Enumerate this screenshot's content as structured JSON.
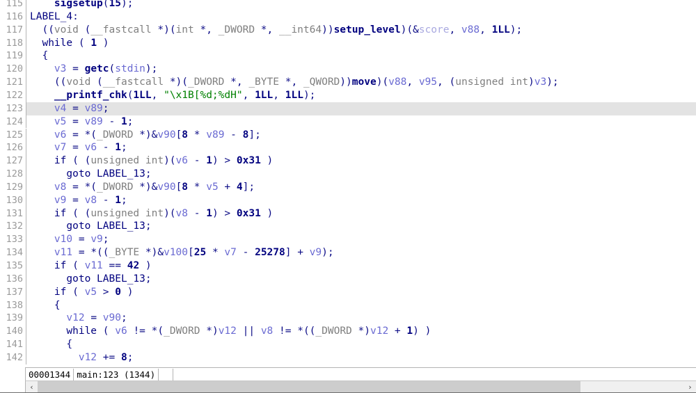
{
  "view": {
    "kind": "hex-rays-pseudocode",
    "first_visible_line": 115,
    "highlighted_line": 123,
    "colors": {
      "background": "#ffffff",
      "highlight": "#e3e3e3",
      "gutter_text": "#9a9a9a",
      "keyword": "#00007f",
      "type": "#7f7f7f",
      "function": "#00007f",
      "local_var": "#6a6ad2",
      "global_var": "#a9a9e0",
      "number": "#00007f",
      "string": "#008000"
    }
  },
  "lines": [
    {
      "num": "115",
      "tokens": [
        {
          "t": "    ",
          "c": "t-plain"
        },
        {
          "t": "sigsetup",
          "c": "t-fn"
        },
        {
          "t": "(",
          "c": "t-plain"
        },
        {
          "t": "15",
          "c": "t-num"
        },
        {
          "t": ");",
          "c": "t-plain"
        }
      ]
    },
    {
      "num": "116",
      "tokens": [
        {
          "t": "LABEL_4",
          "c": "t-label"
        },
        {
          "t": ":",
          "c": "t-plain"
        }
      ]
    },
    {
      "num": "117",
      "tokens": [
        {
          "t": "  ((",
          "c": "t-plain"
        },
        {
          "t": "void",
          "c": "t-type"
        },
        {
          "t": " (",
          "c": "t-plain"
        },
        {
          "t": "__fastcall",
          "c": "t-type"
        },
        {
          "t": " *)(",
          "c": "t-plain"
        },
        {
          "t": "int",
          "c": "t-type"
        },
        {
          "t": " *, ",
          "c": "t-plain"
        },
        {
          "t": "_DWORD",
          "c": "t-type"
        },
        {
          "t": " *, ",
          "c": "t-plain"
        },
        {
          "t": "__int64",
          "c": "t-type"
        },
        {
          "t": "))",
          "c": "t-plain"
        },
        {
          "t": "setup_level",
          "c": "t-fn"
        },
        {
          "t": ")(&",
          "c": "t-plain"
        },
        {
          "t": "score",
          "c": "t-gvar"
        },
        {
          "t": ", ",
          "c": "t-plain"
        },
        {
          "t": "v88",
          "c": "t-var"
        },
        {
          "t": ", ",
          "c": "t-plain"
        },
        {
          "t": "1LL",
          "c": "t-num"
        },
        {
          "t": ");",
          "c": "t-plain"
        }
      ]
    },
    {
      "num": "118",
      "tokens": [
        {
          "t": "  ",
          "c": "t-plain"
        },
        {
          "t": "while",
          "c": "t-kw"
        },
        {
          "t": " ( ",
          "c": "t-plain"
        },
        {
          "t": "1",
          "c": "t-num"
        },
        {
          "t": " )",
          "c": "t-plain"
        }
      ]
    },
    {
      "num": "119",
      "tokens": [
        {
          "t": "  {",
          "c": "t-plain"
        }
      ]
    },
    {
      "num": "120",
      "tokens": [
        {
          "t": "    ",
          "c": "t-plain"
        },
        {
          "t": "v3",
          "c": "t-var"
        },
        {
          "t": " = ",
          "c": "t-plain"
        },
        {
          "t": "getc",
          "c": "t-fn"
        },
        {
          "t": "(",
          "c": "t-plain"
        },
        {
          "t": "stdin",
          "c": "t-var"
        },
        {
          "t": ");",
          "c": "t-plain"
        }
      ]
    },
    {
      "num": "121",
      "tokens": [
        {
          "t": "    ((",
          "c": "t-plain"
        },
        {
          "t": "void",
          "c": "t-type"
        },
        {
          "t": " (",
          "c": "t-plain"
        },
        {
          "t": "__fastcall",
          "c": "t-type"
        },
        {
          "t": " *)(",
          "c": "t-plain"
        },
        {
          "t": "_DWORD",
          "c": "t-type"
        },
        {
          "t": " *, ",
          "c": "t-plain"
        },
        {
          "t": "_BYTE",
          "c": "t-type"
        },
        {
          "t": " *, ",
          "c": "t-plain"
        },
        {
          "t": "_QWORD",
          "c": "t-type"
        },
        {
          "t": "))",
          "c": "t-plain"
        },
        {
          "t": "move",
          "c": "t-fn"
        },
        {
          "t": ")(",
          "c": "t-plain"
        },
        {
          "t": "v88",
          "c": "t-var"
        },
        {
          "t": ", ",
          "c": "t-plain"
        },
        {
          "t": "v95",
          "c": "t-var"
        },
        {
          "t": ", (",
          "c": "t-plain"
        },
        {
          "t": "unsigned int",
          "c": "t-type"
        },
        {
          "t": ")",
          "c": "t-plain"
        },
        {
          "t": "v3",
          "c": "t-var"
        },
        {
          "t": ");",
          "c": "t-plain"
        }
      ]
    },
    {
      "num": "122",
      "tokens": [
        {
          "t": "    ",
          "c": "t-plain"
        },
        {
          "t": "__printf_chk",
          "c": "t-fn"
        },
        {
          "t": "(",
          "c": "t-plain"
        },
        {
          "t": "1LL",
          "c": "t-num"
        },
        {
          "t": ", ",
          "c": "t-plain"
        },
        {
          "t": "\"\\x1B[%d;%dH\"",
          "c": "t-str"
        },
        {
          "t": ", ",
          "c": "t-plain"
        },
        {
          "t": "1LL",
          "c": "t-num"
        },
        {
          "t": ", ",
          "c": "t-plain"
        },
        {
          "t": "1LL",
          "c": "t-num"
        },
        {
          "t": ");",
          "c": "t-plain"
        }
      ]
    },
    {
      "num": "123",
      "highlight": true,
      "tokens": [
        {
          "t": "    ",
          "c": "t-plain"
        },
        {
          "t": "v4",
          "c": "t-var"
        },
        {
          "t": " = ",
          "c": "t-plain"
        },
        {
          "t": "v89",
          "c": "t-var"
        },
        {
          "t": ";",
          "c": "t-plain"
        }
      ]
    },
    {
      "num": "124",
      "tokens": [
        {
          "t": "    ",
          "c": "t-plain"
        },
        {
          "t": "v5",
          "c": "t-var"
        },
        {
          "t": " = ",
          "c": "t-plain"
        },
        {
          "t": "v89",
          "c": "t-var"
        },
        {
          "t": " - ",
          "c": "t-plain"
        },
        {
          "t": "1",
          "c": "t-num"
        },
        {
          "t": ";",
          "c": "t-plain"
        }
      ]
    },
    {
      "num": "125",
      "tokens": [
        {
          "t": "    ",
          "c": "t-plain"
        },
        {
          "t": "v6",
          "c": "t-var"
        },
        {
          "t": " = *(",
          "c": "t-plain"
        },
        {
          "t": "_DWORD",
          "c": "t-type"
        },
        {
          "t": " *)&",
          "c": "t-plain"
        },
        {
          "t": "v90",
          "c": "t-var"
        },
        {
          "t": "[",
          "c": "t-plain"
        },
        {
          "t": "8",
          "c": "t-num"
        },
        {
          "t": " * ",
          "c": "t-plain"
        },
        {
          "t": "v89",
          "c": "t-var"
        },
        {
          "t": " - ",
          "c": "t-plain"
        },
        {
          "t": "8",
          "c": "t-num"
        },
        {
          "t": "];",
          "c": "t-plain"
        }
      ]
    },
    {
      "num": "126",
      "tokens": [
        {
          "t": "    ",
          "c": "t-plain"
        },
        {
          "t": "v7",
          "c": "t-var"
        },
        {
          "t": " = ",
          "c": "t-plain"
        },
        {
          "t": "v6",
          "c": "t-var"
        },
        {
          "t": " - ",
          "c": "t-plain"
        },
        {
          "t": "1",
          "c": "t-num"
        },
        {
          "t": ";",
          "c": "t-plain"
        }
      ]
    },
    {
      "num": "127",
      "tokens": [
        {
          "t": "    ",
          "c": "t-plain"
        },
        {
          "t": "if",
          "c": "t-kw"
        },
        {
          "t": " ( (",
          "c": "t-plain"
        },
        {
          "t": "unsigned int",
          "c": "t-type"
        },
        {
          "t": ")(",
          "c": "t-plain"
        },
        {
          "t": "v6",
          "c": "t-var"
        },
        {
          "t": " - ",
          "c": "t-plain"
        },
        {
          "t": "1",
          "c": "t-num"
        },
        {
          "t": ") > ",
          "c": "t-plain"
        },
        {
          "t": "0x31",
          "c": "t-num"
        },
        {
          "t": " )",
          "c": "t-plain"
        }
      ]
    },
    {
      "num": "128",
      "tokens": [
        {
          "t": "      ",
          "c": "t-plain"
        },
        {
          "t": "goto",
          "c": "t-kw"
        },
        {
          "t": " ",
          "c": "t-plain"
        },
        {
          "t": "LABEL_13",
          "c": "t-label"
        },
        {
          "t": ";",
          "c": "t-plain"
        }
      ]
    },
    {
      "num": "129",
      "tokens": [
        {
          "t": "    ",
          "c": "t-plain"
        },
        {
          "t": "v8",
          "c": "t-var"
        },
        {
          "t": " = *(",
          "c": "t-plain"
        },
        {
          "t": "_DWORD",
          "c": "t-type"
        },
        {
          "t": " *)&",
          "c": "t-plain"
        },
        {
          "t": "v90",
          "c": "t-var"
        },
        {
          "t": "[",
          "c": "t-plain"
        },
        {
          "t": "8",
          "c": "t-num"
        },
        {
          "t": " * ",
          "c": "t-plain"
        },
        {
          "t": "v5",
          "c": "t-var"
        },
        {
          "t": " + ",
          "c": "t-plain"
        },
        {
          "t": "4",
          "c": "t-num"
        },
        {
          "t": "];",
          "c": "t-plain"
        }
      ]
    },
    {
      "num": "130",
      "tokens": [
        {
          "t": "    ",
          "c": "t-plain"
        },
        {
          "t": "v9",
          "c": "t-var"
        },
        {
          "t": " = ",
          "c": "t-plain"
        },
        {
          "t": "v8",
          "c": "t-var"
        },
        {
          "t": " - ",
          "c": "t-plain"
        },
        {
          "t": "1",
          "c": "t-num"
        },
        {
          "t": ";",
          "c": "t-plain"
        }
      ]
    },
    {
      "num": "131",
      "tokens": [
        {
          "t": "    ",
          "c": "t-plain"
        },
        {
          "t": "if",
          "c": "t-kw"
        },
        {
          "t": " ( (",
          "c": "t-plain"
        },
        {
          "t": "unsigned int",
          "c": "t-type"
        },
        {
          "t": ")(",
          "c": "t-plain"
        },
        {
          "t": "v8",
          "c": "t-var"
        },
        {
          "t": " - ",
          "c": "t-plain"
        },
        {
          "t": "1",
          "c": "t-num"
        },
        {
          "t": ") > ",
          "c": "t-plain"
        },
        {
          "t": "0x31",
          "c": "t-num"
        },
        {
          "t": " )",
          "c": "t-plain"
        }
      ]
    },
    {
      "num": "132",
      "tokens": [
        {
          "t": "      ",
          "c": "t-plain"
        },
        {
          "t": "goto",
          "c": "t-kw"
        },
        {
          "t": " ",
          "c": "t-plain"
        },
        {
          "t": "LABEL_13",
          "c": "t-label"
        },
        {
          "t": ";",
          "c": "t-plain"
        }
      ]
    },
    {
      "num": "133",
      "tokens": [
        {
          "t": "    ",
          "c": "t-plain"
        },
        {
          "t": "v10",
          "c": "t-var"
        },
        {
          "t": " = ",
          "c": "t-plain"
        },
        {
          "t": "v9",
          "c": "t-var"
        },
        {
          "t": ";",
          "c": "t-plain"
        }
      ]
    },
    {
      "num": "134",
      "tokens": [
        {
          "t": "    ",
          "c": "t-plain"
        },
        {
          "t": "v11",
          "c": "t-var"
        },
        {
          "t": " = *((",
          "c": "t-plain"
        },
        {
          "t": "_BYTE",
          "c": "t-type"
        },
        {
          "t": " *)&",
          "c": "t-plain"
        },
        {
          "t": "v100",
          "c": "t-var"
        },
        {
          "t": "[",
          "c": "t-plain"
        },
        {
          "t": "25",
          "c": "t-num"
        },
        {
          "t": " * ",
          "c": "t-plain"
        },
        {
          "t": "v7",
          "c": "t-var"
        },
        {
          "t": " - ",
          "c": "t-plain"
        },
        {
          "t": "25278",
          "c": "t-num"
        },
        {
          "t": "] + ",
          "c": "t-plain"
        },
        {
          "t": "v9",
          "c": "t-var"
        },
        {
          "t": ");",
          "c": "t-plain"
        }
      ]
    },
    {
      "num": "135",
      "tokens": [
        {
          "t": "    ",
          "c": "t-plain"
        },
        {
          "t": "if",
          "c": "t-kw"
        },
        {
          "t": " ( ",
          "c": "t-plain"
        },
        {
          "t": "v11",
          "c": "t-var"
        },
        {
          "t": " == ",
          "c": "t-plain"
        },
        {
          "t": "42",
          "c": "t-num"
        },
        {
          "t": " )",
          "c": "t-plain"
        }
      ]
    },
    {
      "num": "136",
      "tokens": [
        {
          "t": "      ",
          "c": "t-plain"
        },
        {
          "t": "goto",
          "c": "t-kw"
        },
        {
          "t": " ",
          "c": "t-plain"
        },
        {
          "t": "LABEL_13",
          "c": "t-label"
        },
        {
          "t": ";",
          "c": "t-plain"
        }
      ]
    },
    {
      "num": "137",
      "tokens": [
        {
          "t": "    ",
          "c": "t-plain"
        },
        {
          "t": "if",
          "c": "t-kw"
        },
        {
          "t": " ( ",
          "c": "t-plain"
        },
        {
          "t": "v5",
          "c": "t-var"
        },
        {
          "t": " > ",
          "c": "t-plain"
        },
        {
          "t": "0",
          "c": "t-num"
        },
        {
          "t": " )",
          "c": "t-plain"
        }
      ]
    },
    {
      "num": "138",
      "tokens": [
        {
          "t": "    {",
          "c": "t-plain"
        }
      ]
    },
    {
      "num": "139",
      "tokens": [
        {
          "t": "      ",
          "c": "t-plain"
        },
        {
          "t": "v12",
          "c": "t-var"
        },
        {
          "t": " = ",
          "c": "t-plain"
        },
        {
          "t": "v90",
          "c": "t-var"
        },
        {
          "t": ";",
          "c": "t-plain"
        }
      ]
    },
    {
      "num": "140",
      "tokens": [
        {
          "t": "      ",
          "c": "t-plain"
        },
        {
          "t": "while",
          "c": "t-kw"
        },
        {
          "t": " ( ",
          "c": "t-plain"
        },
        {
          "t": "v6",
          "c": "t-var"
        },
        {
          "t": " != *(",
          "c": "t-plain"
        },
        {
          "t": "_DWORD",
          "c": "t-type"
        },
        {
          "t": " *)",
          "c": "t-plain"
        },
        {
          "t": "v12",
          "c": "t-var"
        },
        {
          "t": " || ",
          "c": "t-plain"
        },
        {
          "t": "v8",
          "c": "t-var"
        },
        {
          "t": " != *((",
          "c": "t-plain"
        },
        {
          "t": "_DWORD",
          "c": "t-type"
        },
        {
          "t": " *)",
          "c": "t-plain"
        },
        {
          "t": "v12",
          "c": "t-var"
        },
        {
          "t": " + ",
          "c": "t-plain"
        },
        {
          "t": "1",
          "c": "t-num"
        },
        {
          "t": ") )",
          "c": "t-plain"
        }
      ]
    },
    {
      "num": "141",
      "tokens": [
        {
          "t": "      {",
          "c": "t-plain"
        }
      ]
    },
    {
      "num": "142",
      "tokens": [
        {
          "t": "        ",
          "c": "t-plain"
        },
        {
          "t": "v12",
          "c": "t-var"
        },
        {
          "t": " += ",
          "c": "t-plain"
        },
        {
          "t": "8",
          "c": "t-num"
        },
        {
          "t": ";",
          "c": "t-plain"
        }
      ]
    }
  ],
  "status_bar": {
    "address": "00001344",
    "location": "main:123 (1344)",
    "extra": ""
  },
  "scrollbar": {
    "left_arrow": "‹",
    "right_arrow": "›",
    "thumb_fraction": 0.84
  }
}
